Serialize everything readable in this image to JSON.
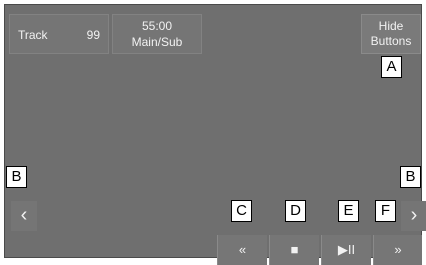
{
  "info": {
    "track_label": "Track",
    "track_number": "99",
    "time": "55:00",
    "mode": "Main/Sub"
  },
  "hide_button": {
    "line1": "Hide",
    "line2": "Buttons"
  },
  "callouts": {
    "a": "A",
    "b_left": "B",
    "b_right": "B",
    "c": "C",
    "d": "D",
    "e": "E",
    "f": "F"
  },
  "nav": {
    "prev_icon": "‹",
    "next_icon": "›"
  },
  "controls": {
    "rewind_icon": "«",
    "stop_icon": "■",
    "play_pause_icon": "▶II",
    "fast_forward_icon": "»"
  }
}
